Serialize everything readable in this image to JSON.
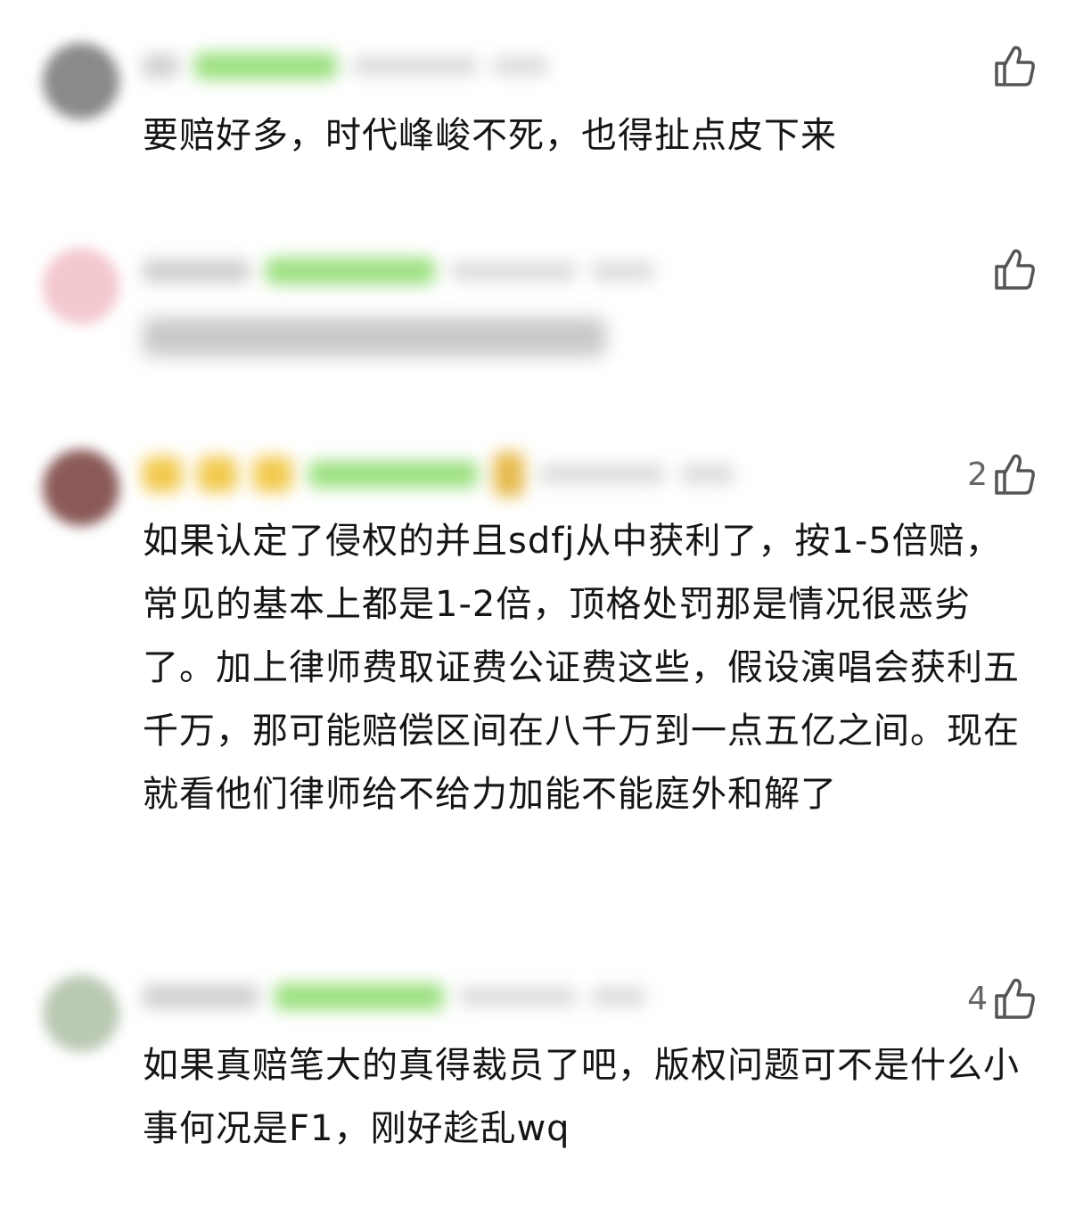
{
  "comments": [
    {
      "text": "要赔好多，时代峰峻不死，也得扯点皮下来",
      "likes": "",
      "avatar_color": "#8a8a8a"
    },
    {
      "text": "",
      "likes": "",
      "avatar_color": "#f3c8cf"
    },
    {
      "text": "如果认定了侵权的并且sdfj从中获利了，按1-5倍赔，常见的基本上都是1-2倍，顶格处罚那是情况很恶劣了。加上律师费取证费公证费这些，假设演唱会获利五千万，那可能赔偿区间在八千万到一点五亿之间。现在就看他们律师给不给力加能不能庭外和解了",
      "likes": "2",
      "avatar_color": "#8a5a58"
    },
    {
      "text": "如果真赔笔大的真得裁员了吧，版权问题可不是什么小事何况是F1，刚好趁乱wq",
      "likes": "4",
      "avatar_color": "#b9c9b2"
    }
  ],
  "colors": {
    "badge": "#9be07f",
    "text": "#151515",
    "like_icon": "#555555"
  },
  "icons": {
    "like": "thumbs-up-icon"
  }
}
